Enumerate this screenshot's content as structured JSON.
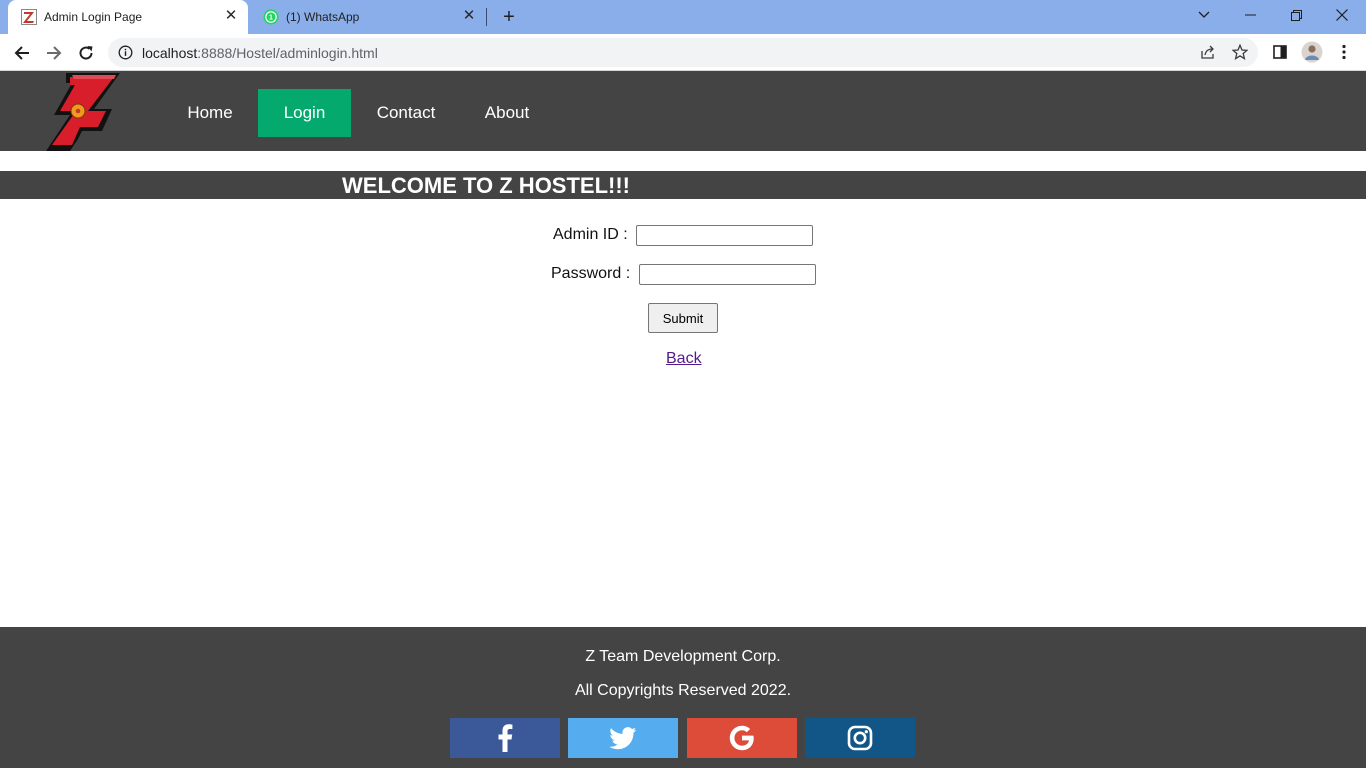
{
  "browser": {
    "tabs": [
      {
        "title": "Admin Login Page",
        "active": true,
        "favicon": "site-logo-icon"
      },
      {
        "title": "(1) WhatsApp",
        "active": false,
        "favicon": "whatsapp-icon",
        "badge": "1"
      }
    ],
    "new_tab_symbol": "+",
    "url_host": "localhost",
    "url_rest": ":8888/Hostel/adminlogin.html"
  },
  "nav": {
    "items": [
      {
        "label": "Home",
        "active": false
      },
      {
        "label": "Login",
        "active": true
      },
      {
        "label": "Contact",
        "active": false
      },
      {
        "label": "About",
        "active": false
      }
    ],
    "active_color": "#04aa6d",
    "bar_color": "#444444"
  },
  "welcome": {
    "text": "WELCOME TO Z HOSTEL!!!"
  },
  "form": {
    "admin_id_label": "Admin ID :",
    "admin_id_value": "",
    "password_label": "Password :",
    "password_value": "",
    "submit_label": "Submit",
    "back_label": "Back"
  },
  "footer": {
    "company": "Z Team Development Corp.",
    "copyright": "All Copyrights Reserved 2022.",
    "social": [
      {
        "name": "facebook-icon",
        "color": "#3b5998"
      },
      {
        "name": "twitter-icon",
        "color": "#55acee"
      },
      {
        "name": "google-icon",
        "color": "#dd4b39"
      },
      {
        "name": "instagram-icon",
        "color": "#125688"
      }
    ]
  }
}
